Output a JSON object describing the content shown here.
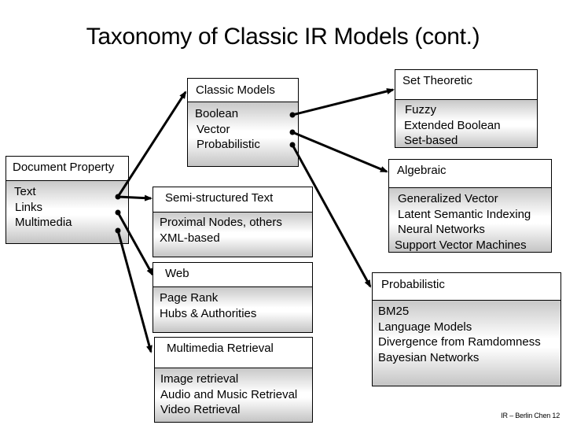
{
  "title": "Taxonomy of Classic IR Models (cont.)",
  "boxes": {
    "document_property": {
      "header": "Document Property",
      "items": [
        "Text",
        "Links",
        "Multimedia"
      ]
    },
    "classic_models": {
      "header": "Classic Models",
      "items": [
        "Boolean",
        "Vector",
        "Probabilistic"
      ]
    },
    "set_theoretic": {
      "header": "Set Theoretic",
      "items": [
        "Fuzzy",
        "Extended Boolean",
        "Set-based"
      ]
    },
    "algebraic": {
      "header": "Algebraic",
      "items": [
        "Generalized Vector",
        "Latent Semantic Indexing",
        "Neural Networks",
        "Support Vector Machines"
      ]
    },
    "probabilistic": {
      "header": "Probabilistic",
      "items": [
        "BM25",
        "Language Models",
        "Divergence from Ramdomness",
        "Bayesian Networks"
      ]
    },
    "semi_structured": {
      "header": "Semi-structured Text",
      "items": [
        "Proximal Nodes, others",
        "XML-based"
      ]
    },
    "web": {
      "header": "Web",
      "items": [
        "Page Rank",
        "Hubs & Authorities"
      ]
    },
    "multimedia": {
      "header": "Multimedia Retrieval",
      "items": [
        "Image retrieval",
        "Audio and Music Retrieval",
        "Video Retrieval"
      ]
    }
  },
  "edges": [
    {
      "from": "document_property.Text",
      "to": "classic_models"
    },
    {
      "from": "document_property.Text",
      "to": "semi_structured"
    },
    {
      "from": "document_property.Links",
      "to": "web"
    },
    {
      "from": "document_property.Multimedia",
      "to": "multimedia"
    },
    {
      "from": "classic_models.Boolean",
      "to": "set_theoretic"
    },
    {
      "from": "classic_models.Vector",
      "to": "algebraic"
    },
    {
      "from": "classic_models.Probabilistic",
      "to": "probabilistic"
    }
  ],
  "footer": "IR – Berlin Chen 12"
}
